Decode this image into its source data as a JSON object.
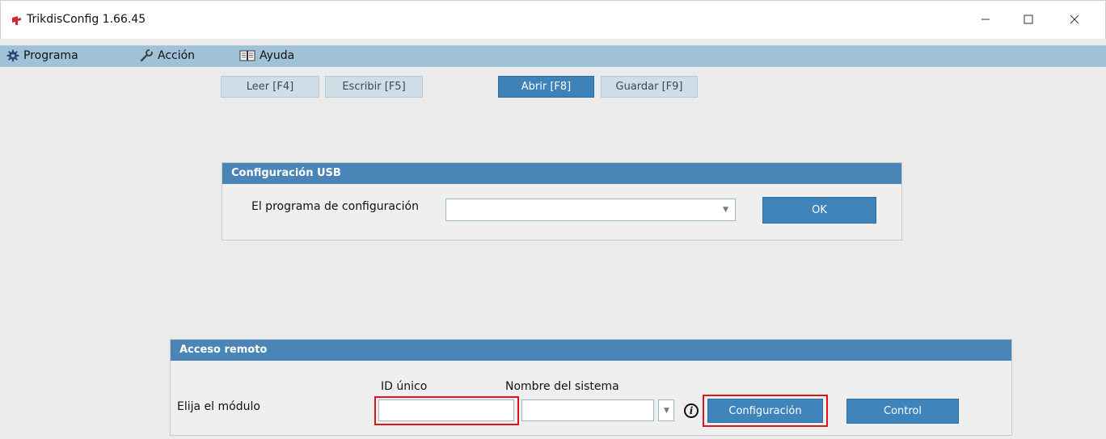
{
  "window": {
    "title": "TrikdisConfig 1.66.45"
  },
  "menu": [
    {
      "label": "Programa",
      "icon": "gear-icon"
    },
    {
      "label": "Acción",
      "icon": "wrench-icon"
    },
    {
      "label": "Ayuda",
      "icon": "book-icon"
    }
  ],
  "toolbar": {
    "read": "Leer [F4]",
    "write": "Escribir [F5]",
    "open": "Abrir [F8]",
    "save": "Guardar [F9]"
  },
  "usb": {
    "header": "Configuración USB",
    "label": "El programa de configuración",
    "selected": "",
    "ok": "OK"
  },
  "remote": {
    "header": "Acceso remoto",
    "module_label": "Elija el módulo",
    "id_label": "ID único",
    "id_value": "",
    "name_label": "Nombre del sistema",
    "name_value": "",
    "config_button": "Configuración",
    "control_button": "Control"
  },
  "colors": {
    "accent": "#3f84bb",
    "menubar": "#9fc2d8",
    "highlight": "#e0121b"
  }
}
